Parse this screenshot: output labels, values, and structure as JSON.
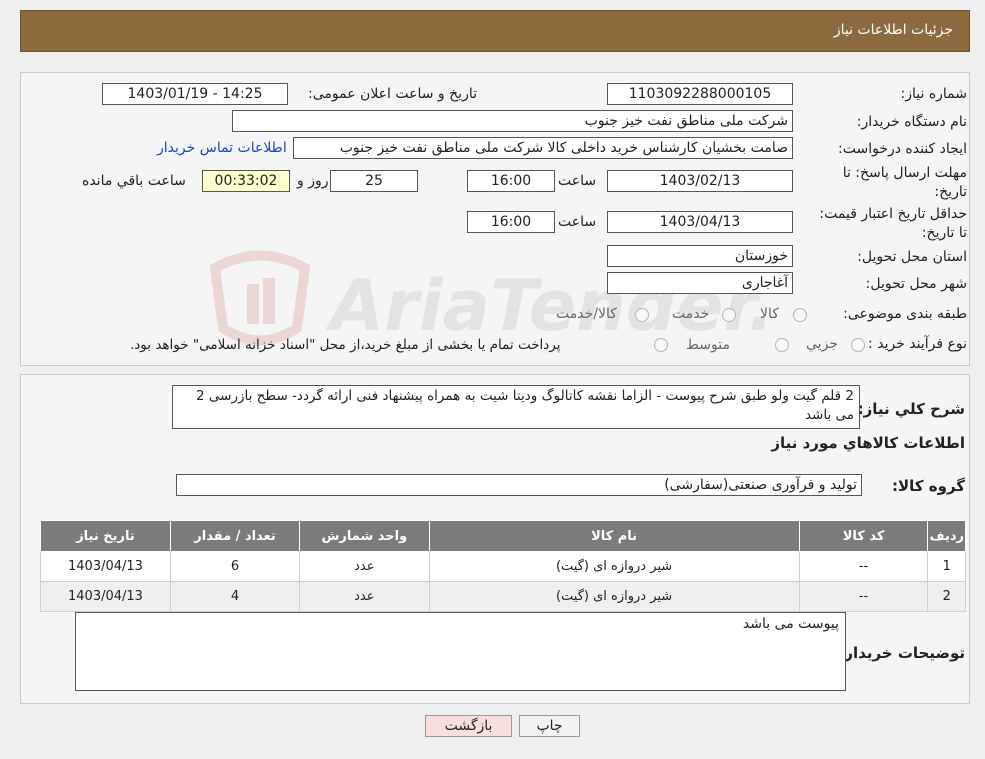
{
  "header": {
    "title": "جزئیات اطلاعات نیاز"
  },
  "form": {
    "need_number_label": "شماره نیاز:",
    "need_number": "1103092288000105",
    "announce_label": "تاریخ و ساعت اعلان عمومی:",
    "announce_value": "1403/01/19 - 14:25",
    "buyer_org_label": "نام دستگاه خریدار:",
    "buyer_org": "شرکت ملی مناطق نفت خیز جنوب",
    "creator_label": "ایجاد کننده درخواست:",
    "creator": "صامت  بخشیان  کارشناس خرید داخلی کالا  شرکت ملی مناطق نفت خیز جنوب",
    "contact_link": "اطلاعات تماس خریدار",
    "reply_deadline_label": "مهلت ارسال پاسخ: تا تاریخ:",
    "reply_date": "1403/02/13",
    "time_label": "ساعت",
    "reply_time": "16:00",
    "days": "25",
    "days_label": "روز و",
    "remaining": "00:33:02",
    "remaining_label": "ساعت باقي مانده",
    "price_validity_label": "حداقل تاریخ اعتبار قیمت: تا تاریخ:",
    "price_date": "1403/04/13",
    "price_time": "16:00",
    "province_label": "استان محل تحویل:",
    "province": "خوزستان",
    "city_label": "شهر محل تحویل:",
    "city": "آغاجاری",
    "category_label": "طبقه بندی موضوعی:",
    "category_options": [
      "کالا",
      "خدمت",
      "کالا/خدمت"
    ],
    "process_label": "نوع فرآیند خرید :",
    "process_options": [
      "جزیي",
      "متوسط"
    ],
    "process_note": "پرداخت تمام یا بخشی از مبلغ خرید،از محل \"اسناد خزانه اسلامی\" خواهد بود."
  },
  "details": {
    "description_label": "شرح کلي نیاز:",
    "description": "2 قلم گیت ولو طبق شرح پیوست - الزاما نقشه کاتالوگ ودیتا شیت به همراه پیشنهاد فنی ارائه گردد- سطح بازرسی 2 می باشد",
    "goods_info_title": "اطلاعات کالاهاي مورد نیاز",
    "goods_group_label": "گروه کالا:",
    "goods_group": "تولید و فرآوری صنعتی(سفارشی)",
    "table_headers": [
      "ردیف",
      "کد کالا",
      "نام کالا",
      "واحد شمارش",
      "تعداد / مقدار",
      "تاریخ نیاز"
    ],
    "rows": [
      [
        "1",
        "--",
        "شیر دروازه ای (گیت)",
        "عدد",
        "6",
        "1403/04/13"
      ],
      [
        "2",
        "--",
        "شیر دروازه ای (گیت)",
        "عدد",
        "4",
        "1403/04/13"
      ]
    ],
    "buyer_notes_label": "توضیحات خریدار:",
    "buyer_notes": "پیوست می باشد"
  },
  "buttons": {
    "print": "چاپ",
    "back": "بازگشت"
  },
  "watermark": {
    "text": "AriaTender.neT"
  },
  "colors": {
    "header_bg": "#8c6a3d",
    "table_header_bg": "#7b7b7b",
    "remaining_bg": "#ffffcc",
    "link": "#1a44c4",
    "back_btn_bg": "#f9dede"
  }
}
